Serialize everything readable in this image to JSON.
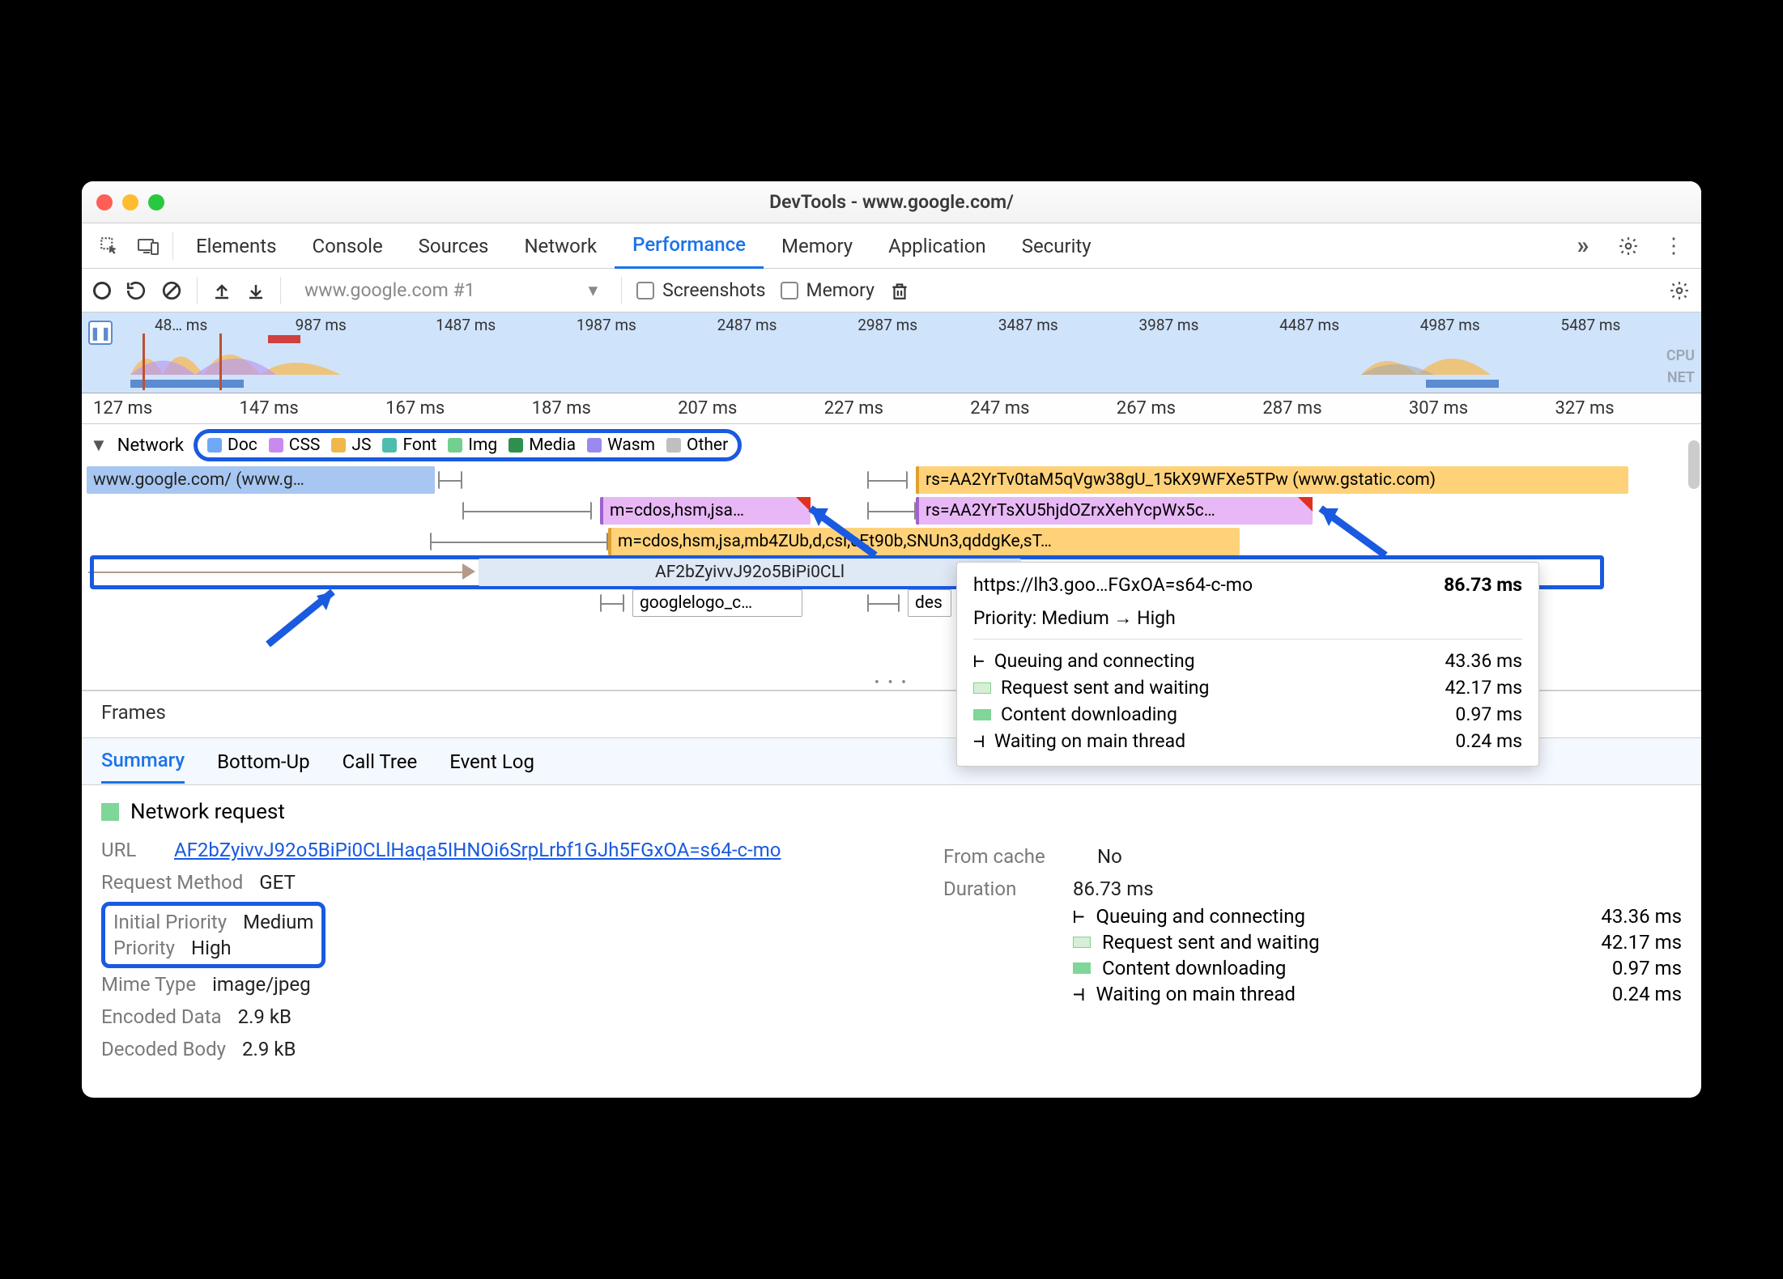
{
  "window": {
    "title": "DevTools - www.google.com/"
  },
  "tabs": {
    "items": [
      "Elements",
      "Console",
      "Sources",
      "Network",
      "Performance",
      "Memory",
      "Application",
      "Security"
    ],
    "active": "Performance"
  },
  "toolbar": {
    "selector": "www.google.com #1",
    "screenshots_label": "Screenshots",
    "memory_label": "Memory"
  },
  "overview": {
    "ticks": [
      "48… ms",
      "987 ms",
      "1487 ms",
      "1987 ms",
      "2487 ms",
      "2987 ms",
      "3487 ms",
      "3987 ms",
      "4487 ms",
      "4987 ms",
      "5487 ms"
    ],
    "sidelabels": {
      "cpu": "CPU",
      "net": "NET"
    }
  },
  "ruler": [
    "127 ms",
    "147 ms",
    "167 ms",
    "187 ms",
    "207 ms",
    "227 ms",
    "247 ms",
    "267 ms",
    "287 ms",
    "307 ms",
    "327 ms"
  ],
  "network": {
    "label": "Network",
    "legend": [
      {
        "label": "Doc",
        "color": "#6fa8f5"
      },
      {
        "label": "CSS",
        "color": "#c98af0"
      },
      {
        "label": "JS",
        "color": "#f0b84a"
      },
      {
        "label": "Font",
        "color": "#4fbcb0"
      },
      {
        "label": "Img",
        "color": "#72cf8f"
      },
      {
        "label": "Media",
        "color": "#2f8f4f"
      },
      {
        "label": "Wasm",
        "color": "#9a8af0"
      },
      {
        "label": "Other",
        "color": "#bfbfbf"
      }
    ],
    "bars": {
      "doc": "www.google.com/ (www.g…",
      "gs1": "rs=AA2YrTv0taM5qVgw38gU_15kX9WFXe5TPw (www.gstatic.com)",
      "css1": "m=cdos,hsm,jsa…",
      "css2": "rs=AA2YrTsXU5hjdOZrxXehYcpWx5c…",
      "js2": "m=cdos,hsm,jsa,mb4ZUb,d,csi,cEt90b,SNUn3,qddgKe,sT…",
      "sel": "AF2bZyivvJ92o5BiPi0CLl",
      "gl": "googlelogo_c…",
      "des": "des"
    }
  },
  "tooltip": {
    "url": "https://lh3.goo…FGxOA=s64-c-mo",
    "total": "86.73 ms",
    "priority_label": "Priority: Medium → High",
    "rows": [
      {
        "label": "Queuing and connecting",
        "value": "43.36 ms",
        "glyph": "bracket"
      },
      {
        "label": "Request sent and waiting",
        "value": "42.17 ms",
        "glyph": "lightgreen"
      },
      {
        "label": "Content downloading",
        "value": "0.97 ms",
        "glyph": "green"
      },
      {
        "label": "Waiting on main thread",
        "value": "0.24 ms",
        "glyph": "endbracket"
      }
    ]
  },
  "frames_label": "Frames",
  "subtabs": {
    "items": [
      "Summary",
      "Bottom-Up",
      "Call Tree",
      "Event Log"
    ],
    "active": "Summary"
  },
  "summary": {
    "heading": "Network request",
    "url_label": "URL",
    "url": "AF2bZyivvJ92o5BiPi0CLlHaqa5IHNOi6SrpLrbf1GJh5FGxOA=s64-c-mo",
    "method_label": "Request Method",
    "method": "GET",
    "initprio_label": "Initial Priority",
    "initprio": "Medium",
    "prio_label": "Priority",
    "prio": "High",
    "mime_label": "Mime Type",
    "mime": "image/jpeg",
    "enc_label": "Encoded Data",
    "enc": "2.9 kB",
    "dec_label": "Decoded Body",
    "dec": "2.9 kB",
    "cache_label": "From cache",
    "cache": "No",
    "dur_label": "Duration",
    "dur": "86.73 ms",
    "durrows": [
      {
        "label": "Queuing and connecting",
        "value": "43.36 ms"
      },
      {
        "label": "Request sent and waiting",
        "value": "42.17 ms"
      },
      {
        "label": "Content downloading",
        "value": "0.97 ms"
      },
      {
        "label": "Waiting on main thread",
        "value": "0.24 ms"
      }
    ]
  }
}
